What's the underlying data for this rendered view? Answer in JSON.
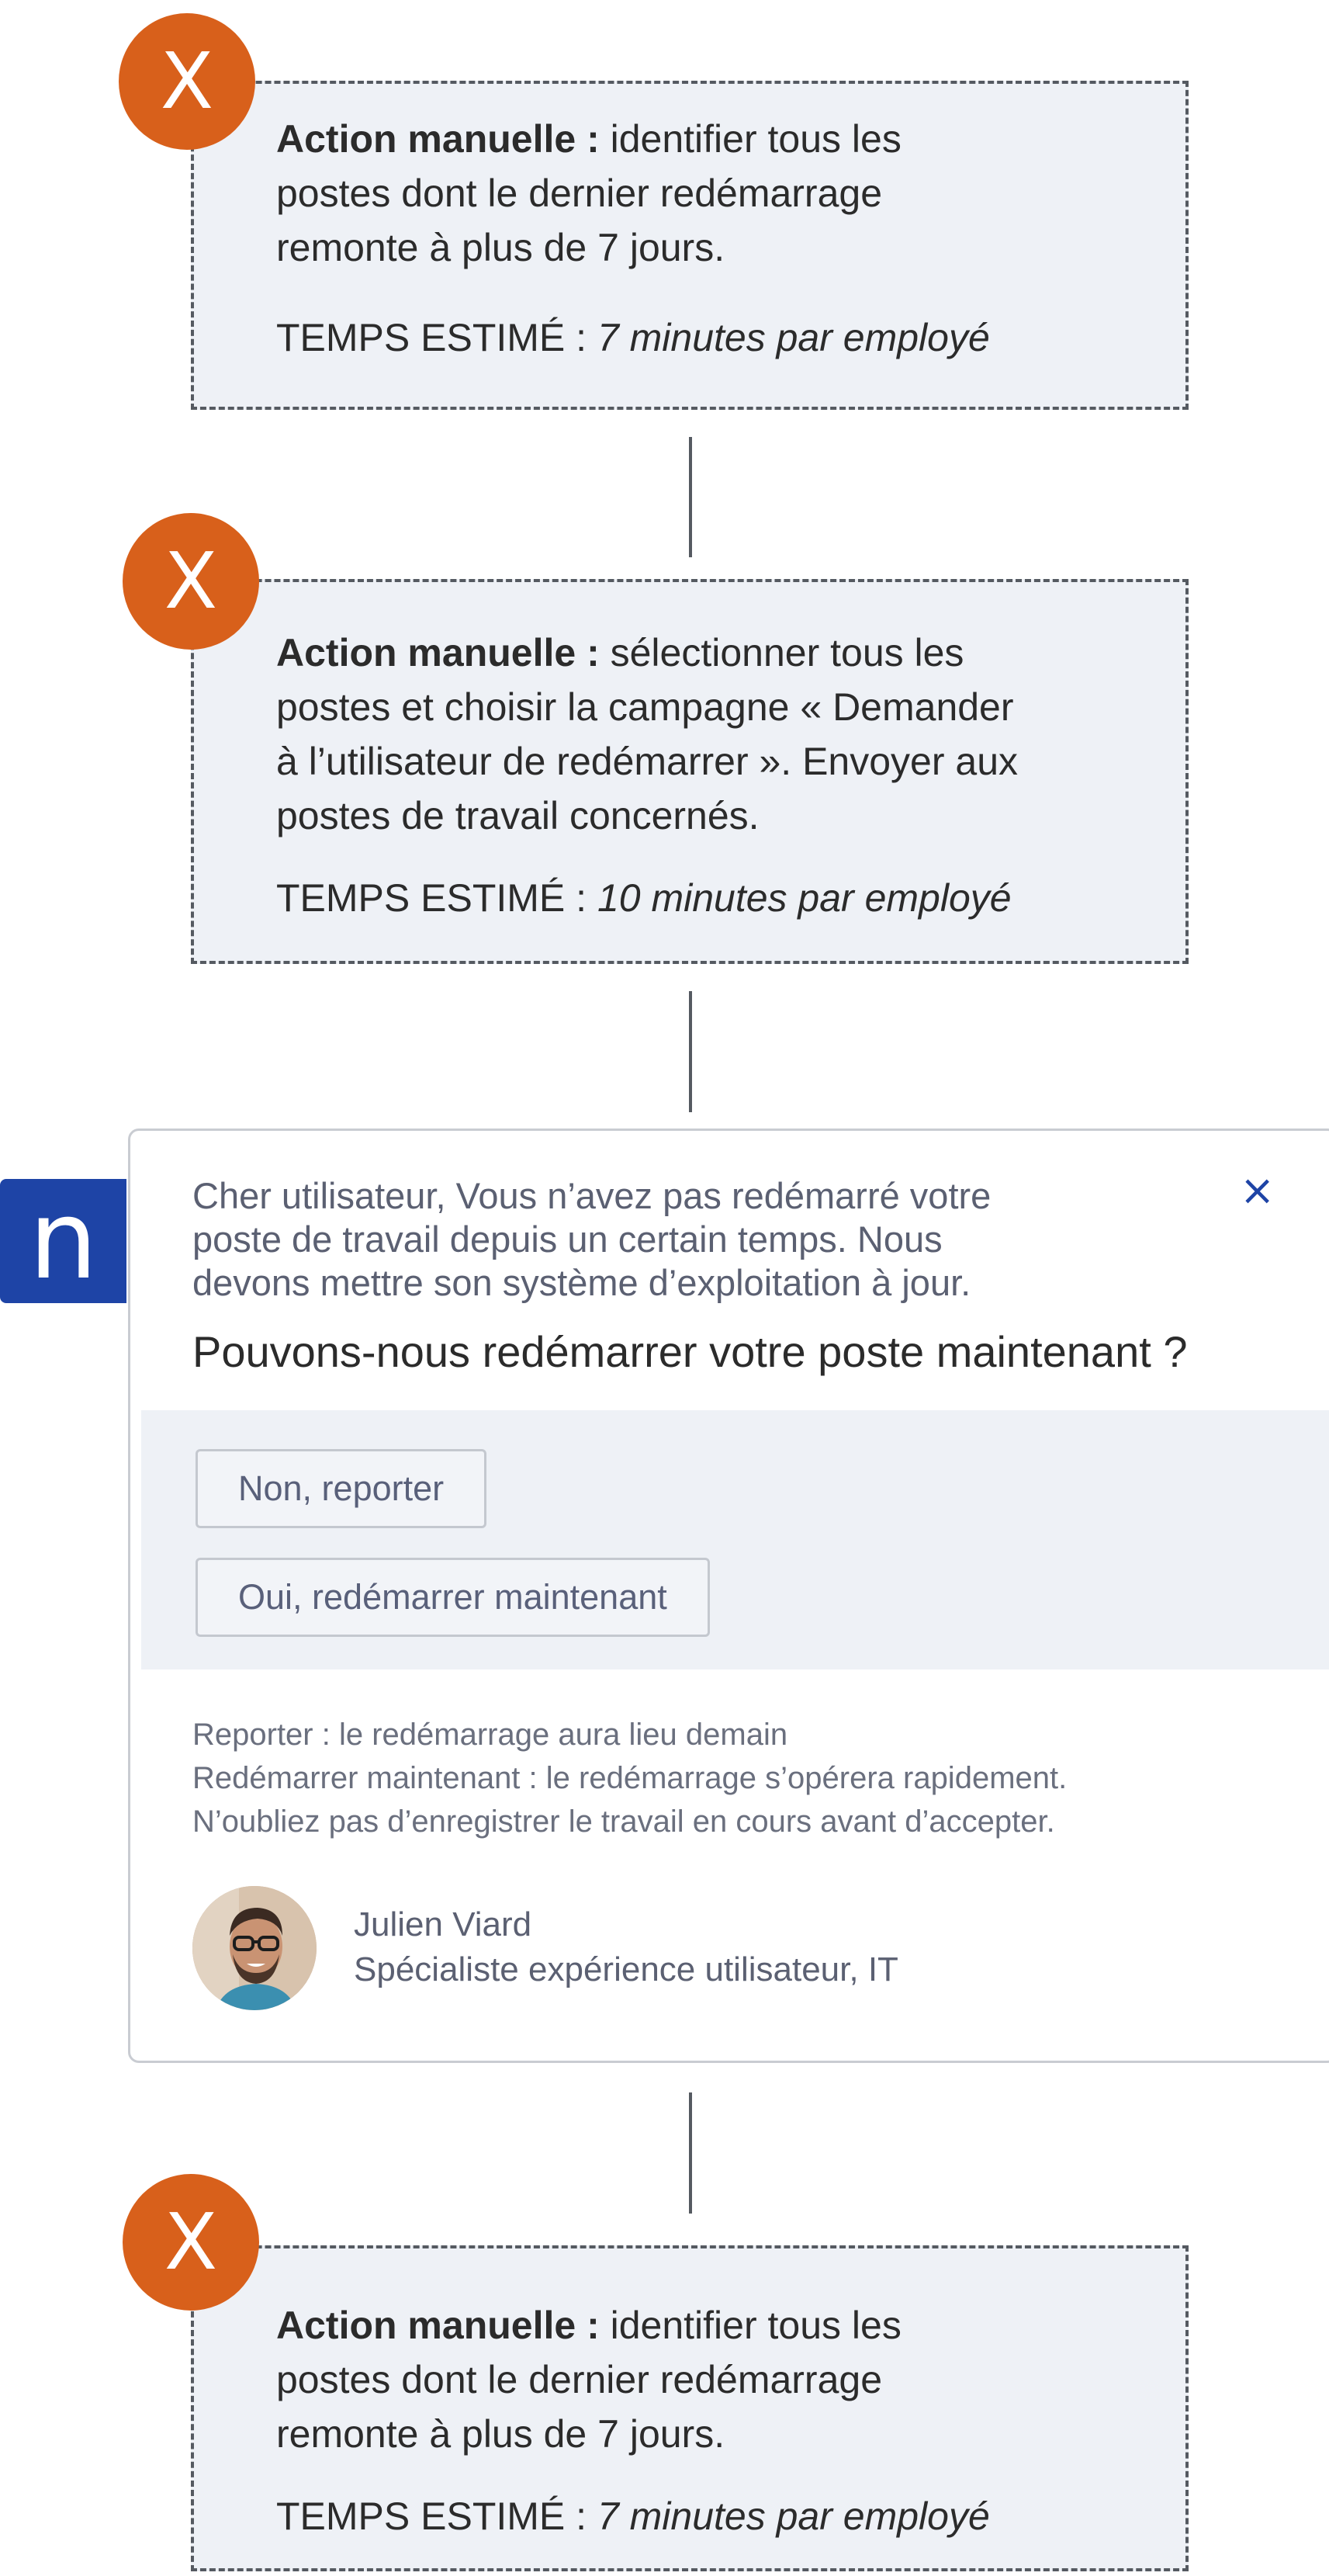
{
  "steps": [
    {
      "badge": "X",
      "action_label": "Action manuelle :",
      "action_lines": [
        " identifier tous les",
        "postes dont le dernier redémarrage",
        "remonte à plus de 7 jours."
      ],
      "time_label": "TEMPS ESTIMÉ : ",
      "time_value": "7 minutes par employé"
    },
    {
      "badge": "X",
      "action_label": "Action manuelle :",
      "action_lines": [
        " sélectionner tous les",
        "postes et choisir la campagne « Demander",
        "à l’utilisateur de redémarrer ». Envoyer aux",
        "postes de travail concernés."
      ],
      "time_label": "TEMPS ESTIMÉ : ",
      "time_value": "10 minutes par employé"
    },
    {
      "badge": "X",
      "action_label": "Action manuelle :",
      "action_lines": [
        " identifier tous les",
        "postes dont le dernier redémarrage",
        "remonte à plus de 7 jours."
      ],
      "time_label": "TEMPS ESTIMÉ : ",
      "time_value": "7 minutes par employé"
    }
  ],
  "notification": {
    "brand_letter": "n",
    "close_symbol": "×",
    "intro_lines": [
      "Cher utilisateur, Vous n’avez pas redémarré votre",
      "poste de travail depuis un certain temps. Nous",
      "devons mettre son système d’exploitation à jour."
    ],
    "question": "Pouvons-nous redémarrer votre poste maintenant ?",
    "button_no": "Non, reporter",
    "button_yes": "Oui, redémarrer maintenant",
    "note_lines": [
      "Reporter : le redémarrage aura lieu demain",
      "Redémarrer maintenant : le redémarrage s’opérera rapidement.",
      "N’oubliez pas d’enregistrer le travail en cours avant d’accepter."
    ],
    "sender_name": "Julien Viard",
    "sender_role": "Spécialiste expérience utilisateur, IT"
  },
  "colors": {
    "badge": "#d8601b",
    "brand": "#1e44a6",
    "box_background": "#eef1f6",
    "dash": "#555a61"
  }
}
